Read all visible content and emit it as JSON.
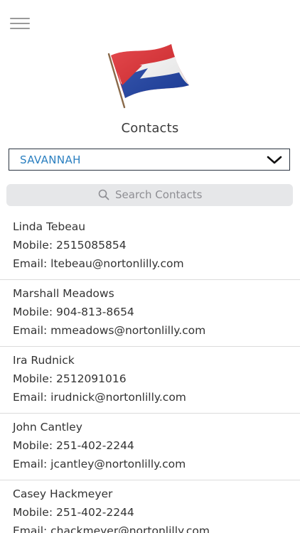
{
  "header": {
    "title": "Contacts"
  },
  "location": {
    "selected": "SAVANNAH"
  },
  "search": {
    "placeholder": "Search Contacts"
  },
  "contacts": [
    {
      "name": "Linda Tebeau",
      "mobile": "Mobile: 2515085854",
      "email": "Email: ltebeau@nortonlilly.com"
    },
    {
      "name": "Marshall Meadows",
      "mobile": "Mobile: 904-813-8654",
      "email": "Email: mmeadows@nortonlilly.com"
    },
    {
      "name": "Ira Rudnick",
      "mobile": "Mobile: 2512091016",
      "email": "Email: irudnick@nortonlilly.com"
    },
    {
      "name": "John Cantley",
      "mobile": "Mobile: 251-402-2244",
      "email": "Email: jcantley@nortonlilly.com"
    },
    {
      "name": "Casey Hackmeyer",
      "mobile": "Mobile: 251-402-2244",
      "email": "Email: chackmeyer@nortonlilly.com"
    }
  ],
  "icons": {
    "menu": "hamburger-menu-icon",
    "logo": "flag-logo-icon",
    "dropdown": "chevron-down-icon",
    "search": "search-icon"
  },
  "colors": {
    "accent": "#2a7fc0",
    "flag_red": "#e02a2f",
    "flag_blue": "#1f43a8",
    "search_bg": "#e6e7e9"
  }
}
